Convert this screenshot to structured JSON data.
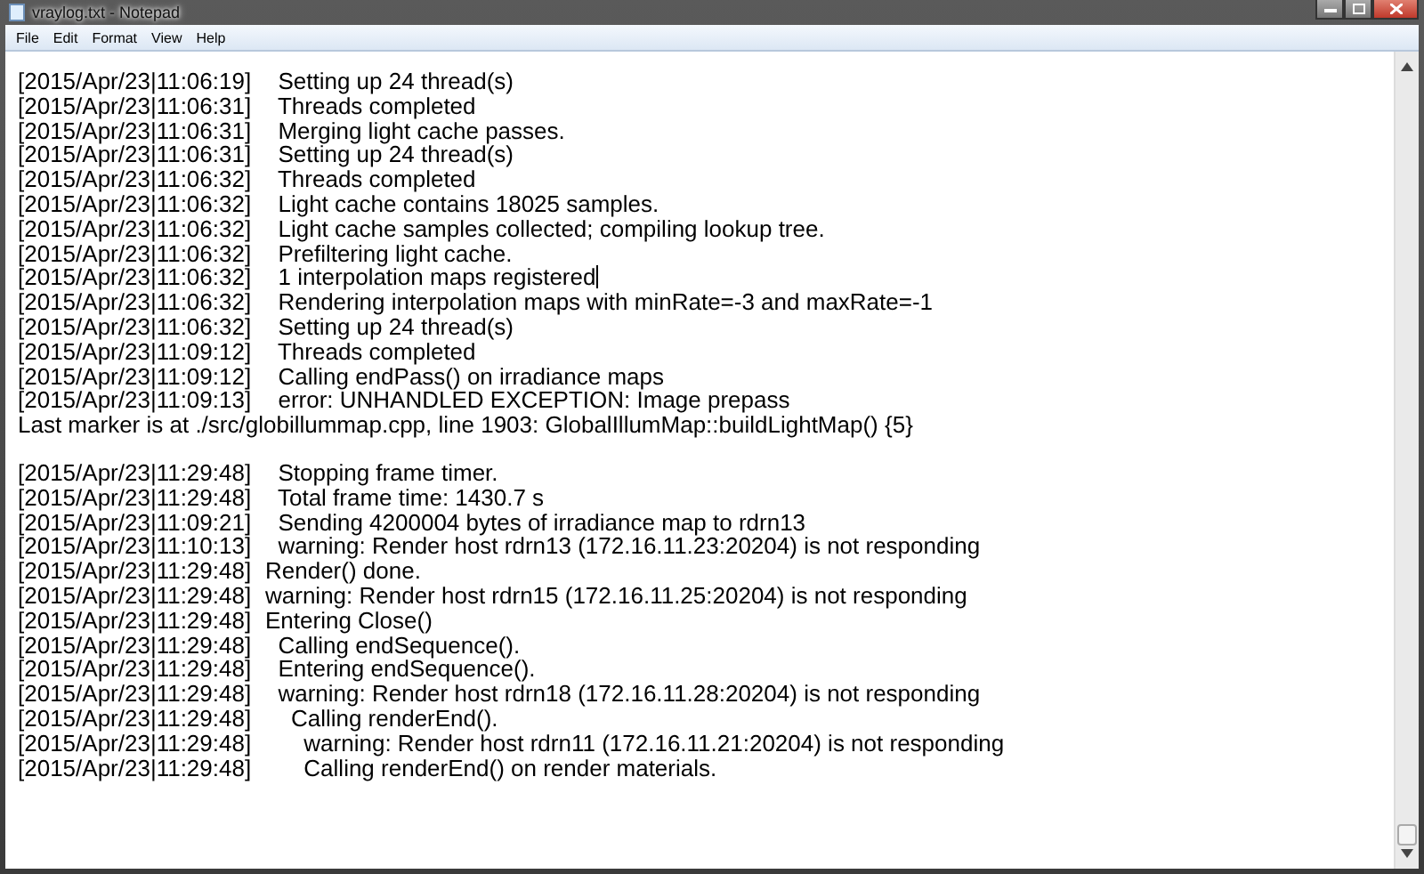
{
  "window": {
    "title": "vraylog.txt - Notepad"
  },
  "menu": [
    "File",
    "Edit",
    "Format",
    "View",
    "Help"
  ],
  "blocks": [
    {
      "lines": [
        {
          "text": "[2015/Apr/23|11:06:19]\t  Setting up 24 thread(s)"
        },
        {
          "text": "[2015/Apr/23|11:06:31]\t  Threads completed"
        },
        {
          "text": "[2015/Apr/23|11:06:31]\t  Merging light cache passes."
        },
        {
          "text": "[2015/Apr/23|11:06:31]\t  Setting up 24 thread(s)"
        },
        {
          "text": "[2015/Apr/23|11:06:32]\t  Threads completed"
        },
        {
          "text": "[2015/Apr/23|11:06:32]\t  Light cache contains 18025 samples."
        },
        {
          "text": "[2015/Apr/23|11:06:32]\t  Light cache samples collected; compiling lookup tree."
        },
        {
          "text": "[2015/Apr/23|11:06:32]\t  Prefiltering light cache."
        },
        {
          "text": "[2015/Apr/23|11:06:32]\t  1 interpolation maps registered",
          "caret": true
        },
        {
          "text": "[2015/Apr/23|11:06:32]\t  Rendering interpolation maps with minRate=-3 and maxRate=-1"
        },
        {
          "text": "[2015/Apr/23|11:06:32]\t  Setting up 24 thread(s)"
        },
        {
          "text": "[2015/Apr/23|11:09:12]\t  Threads completed"
        },
        {
          "text": "[2015/Apr/23|11:09:12]\t  Calling endPass() on irradiance maps"
        },
        {
          "text": "[2015/Apr/23|11:09:13]\t  error: UNHANDLED EXCEPTION: Image prepass"
        },
        {
          "text": "Last marker is at ./src/globillummap.cpp, line 1903: GlobalIllumMap::buildLightMap() {5}"
        }
      ]
    },
    {
      "lines": [
        {
          "text": "[2015/Apr/23|11:29:48]\t  Stopping frame timer."
        },
        {
          "text": "[2015/Apr/23|11:29:48]\t  Total frame time: 1430.7 s"
        },
        {
          "text": "[2015/Apr/23|11:09:21]\t  Sending 4200004 bytes of irradiance map to rdrn13"
        },
        {
          "text": "[2015/Apr/23|11:10:13]\t  warning: Render host rdrn13 (172.16.11.23:20204) is not responding"
        },
        {
          "text": "[2015/Apr/23|11:29:48]\tRender() done."
        },
        {
          "text": "[2015/Apr/23|11:29:48]\twarning: Render host rdrn15 (172.16.11.25:20204) is not responding"
        },
        {
          "text": "[2015/Apr/23|11:29:48]\tEntering Close()"
        },
        {
          "text": "[2015/Apr/23|11:29:48]\t  Calling endSequence()."
        },
        {
          "text": "[2015/Apr/23|11:29:48]\t  Entering endSequence()."
        },
        {
          "text": "[2015/Apr/23|11:29:48]\t  warning: Render host rdrn18 (172.16.11.28:20204) is not responding"
        },
        {
          "text": "[2015/Apr/23|11:29:48]\t    Calling renderEnd()."
        },
        {
          "text": "[2015/Apr/23|11:29:48]\t      warning: Render host rdrn11 (172.16.11.21:20204) is not responding"
        },
        {
          "text": "[2015/Apr/23|11:29:48]\t      Calling renderEnd() on render materials."
        }
      ]
    }
  ]
}
